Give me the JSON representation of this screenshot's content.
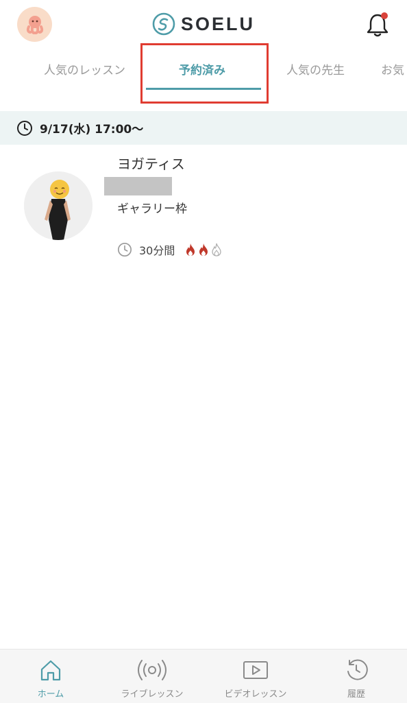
{
  "header": {
    "logo_text": "SOELU",
    "notification_dot": true
  },
  "tabs": [
    {
      "label": "人気のレッスン",
      "active": false
    },
    {
      "label": "予約済み",
      "active": true
    },
    {
      "label": "人気の先生",
      "active": false
    },
    {
      "label": "お気",
      "active": false
    }
  ],
  "schedule": {
    "date_time": "9/17(水) 17:00～"
  },
  "lesson": {
    "title": "ヨガティス",
    "subtitle": "ギャラリー枠",
    "duration": "30分間",
    "intensity": 2,
    "intensity_max": 3
  },
  "bottom_nav": [
    {
      "label": "ホーム",
      "icon": "home-icon",
      "active": true
    },
    {
      "label": "ライブレッスン",
      "icon": "live-broadcast-icon",
      "active": false
    },
    {
      "label": "ビデオレッスン",
      "icon": "video-play-icon",
      "active": false
    },
    {
      "label": "履歴",
      "icon": "history-icon",
      "active": false
    }
  ],
  "colors": {
    "accent": "#4e9ca8",
    "highlight": "#e03c31",
    "flame_active": "#c0392b",
    "flame_inactive": "#b0b0b0"
  }
}
